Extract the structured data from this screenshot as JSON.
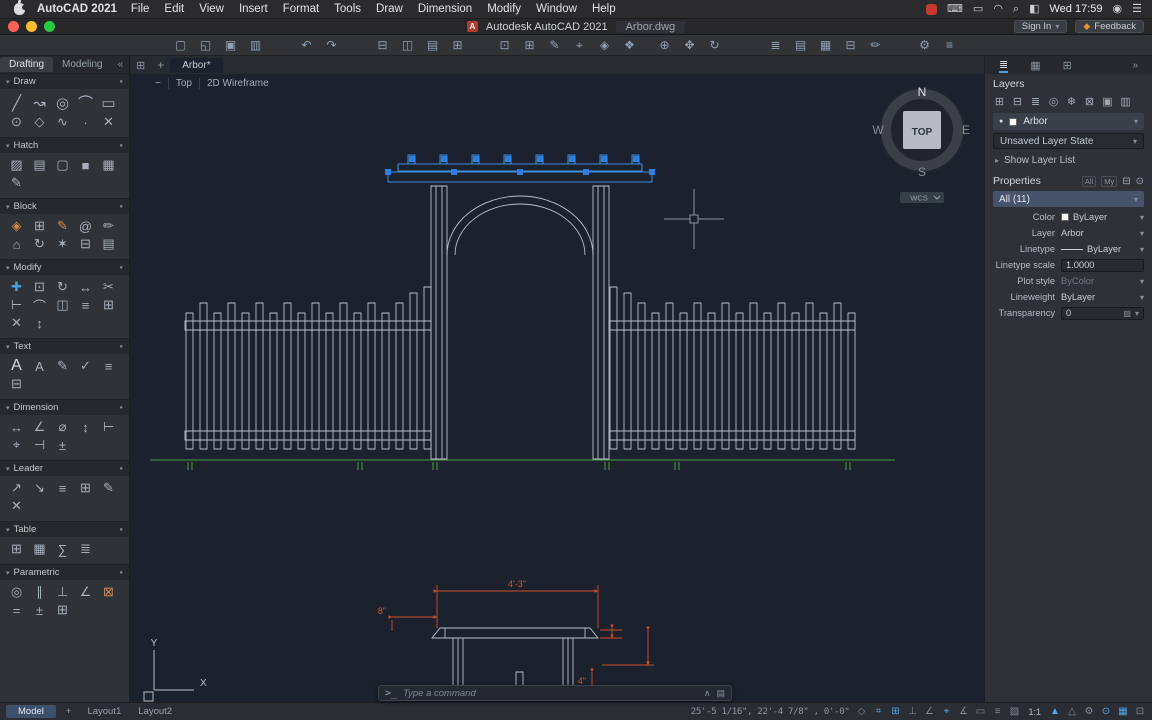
{
  "colors": {
    "selection_blue": "#2e7fe0",
    "accent_blue": "#53a7e8",
    "line_gray": "#b9c0ca",
    "ground_green": "#4f9a4f",
    "dimension_red": "#cf4e2a",
    "feedback_orange": "#e8913a"
  },
  "chrome": {
    "caret_down": "▾",
    "caret_right": "▸",
    "section_dot": "●",
    "collapse_left": "«",
    "collapse_right": "»",
    "plus": "+",
    "grid": "⊞",
    "chevron_up": "∧",
    "history": "▤"
  },
  "menubar": {
    "app_name": "AutoCAD 2021",
    "items": [
      "File",
      "Edit",
      "View",
      "Insert",
      "Format",
      "Tools",
      "Draw",
      "Dimension",
      "Modify",
      "Window",
      "Help"
    ],
    "clock": "Wed 17:59",
    "status_icons": [
      {
        "name": "record-icon",
        "glyph": "",
        "cls": "record"
      },
      {
        "name": "keyboard-input-icon",
        "glyph": "⌨"
      },
      {
        "name": "battery-icon",
        "glyph": "▭"
      },
      {
        "name": "wifi-icon",
        "glyph": "◠"
      },
      {
        "name": "spotlight-icon",
        "glyph": "⌕"
      },
      {
        "name": "control-center-icon",
        "glyph": "◧"
      }
    ],
    "after_clock_icons": [
      {
        "name": "siri-icon",
        "glyph": "◉"
      },
      {
        "name": "notification-center-icon",
        "glyph": "☰"
      }
    ]
  },
  "titlebar": {
    "logo_letter": "A",
    "app_title": "Autodesk AutoCAD 2021",
    "doc_title": "Arbor.dwg",
    "sign_in": "Sign In",
    "feedback": "Feedback"
  },
  "toolbar": {
    "file": [
      {
        "name": "new-file-icon",
        "glyph": "▢"
      },
      {
        "name": "open-file-icon",
        "glyph": "◱"
      },
      {
        "name": "save-icon",
        "glyph": "▣"
      },
      {
        "name": "save-as-icon",
        "glyph": "▥"
      }
    ],
    "edit": [
      {
        "name": "undo-icon",
        "glyph": "↶"
      },
      {
        "name": "redo-icon",
        "glyph": "↷"
      }
    ],
    "print": [
      {
        "name": "print-icon",
        "glyph": "⊟"
      },
      {
        "name": "plot-preview-icon",
        "glyph": "◫"
      },
      {
        "name": "page-setup-icon",
        "glyph": "▤"
      },
      {
        "name": "batch-plot-icon",
        "glyph": "⊞"
      }
    ],
    "tools": [
      {
        "name": "copy-clip-icon",
        "glyph": "⊡"
      },
      {
        "name": "paste-icon",
        "glyph": "⊞"
      },
      {
        "name": "match-properties-icon",
        "glyph": "✎"
      },
      {
        "name": "measure-icon",
        "glyph": "⌖"
      },
      {
        "name": "insert-block-icon",
        "glyph": "◈"
      },
      {
        "name": "group-icon",
        "glyph": "❖"
      }
    ],
    "view": [
      {
        "name": "zoom-icon",
        "glyph": "⊕"
      },
      {
        "name": "pan-icon",
        "glyph": "✥"
      },
      {
        "name": "orbit-icon",
        "glyph": "↻"
      }
    ],
    "manage": [
      {
        "name": "layer-properties-icon",
        "glyph": "≣"
      },
      {
        "name": "properties-palette-icon",
        "glyph": "▤"
      },
      {
        "name": "tool-palettes-icon",
        "glyph": "▦"
      },
      {
        "name": "sheet-set-manager-icon",
        "glyph": "⊟"
      },
      {
        "name": "markup-icon",
        "glyph": "✏"
      }
    ],
    "settings": [
      {
        "name": "workspace-icon",
        "glyph": "⚙"
      },
      {
        "name": "options-icon",
        "glyph": "≡"
      }
    ]
  },
  "palette": {
    "tabs": [
      {
        "label": "Drafting",
        "cls": "active"
      },
      {
        "label": "Modeling"
      }
    ],
    "sections": [
      {
        "label": "Draw",
        "icons": [
          {
            "name": "line-icon",
            "glyph": "╱"
          },
          {
            "name": "polyline-icon",
            "glyph": "↝"
          },
          {
            "name": "circle-icon",
            "glyph": "◎"
          },
          {
            "name": "arc-icon",
            "glyph": "⌒"
          },
          {
            "name": "rectangle-icon",
            "glyph": "▭"
          },
          {
            "name": "ellipse-icon",
            "glyph": "⊙"
          },
          {
            "name": "polygon-icon",
            "glyph": "◇"
          },
          {
            "name": "spline-icon",
            "glyph": "∿"
          },
          {
            "name": "point-icon",
            "glyph": "∙"
          },
          {
            "name": "construction-line-icon",
            "glyph": "✕"
          }
        ]
      },
      {
        "label": "Hatch",
        "icons": [
          {
            "name": "hatch-pattern-icon",
            "glyph": "▨"
          },
          {
            "name": "gradient-icon",
            "glyph": "▤"
          },
          {
            "name": "boundary-icon",
            "glyph": "▢"
          },
          {
            "name": "solid-fill-icon",
            "glyph": "■"
          },
          {
            "name": "hatch-grid-icon",
            "glyph": "▦"
          },
          {
            "name": "hatch-edit-icon",
            "glyph": "✎"
          }
        ]
      },
      {
        "label": "Block",
        "icons": [
          {
            "name": "block-insert-icon",
            "glyph": "◈",
            "cls": "warm"
          },
          {
            "name": "block-create-icon",
            "glyph": "⊞"
          },
          {
            "name": "block-edit-icon",
            "glyph": "✎",
            "cls": "warm"
          },
          {
            "name": "attribute-icon",
            "glyph": "@"
          },
          {
            "name": "attribute-edit-icon",
            "glyph": "✏"
          },
          {
            "name": "set-base-point-icon",
            "glyph": "⌂"
          },
          {
            "name": "block-sync-icon",
            "glyph": "↻"
          },
          {
            "name": "explode-icon",
            "glyph": "✶"
          },
          {
            "name": "block-scan-icon",
            "glyph": "⊟"
          },
          {
            "name": "block-manager-icon",
            "glyph": "▤"
          }
        ]
      },
      {
        "label": "Modify",
        "icons": [
          {
            "name": "move-icon",
            "glyph": "✚",
            "cls": "blue"
          },
          {
            "name": "copy-icon",
            "glyph": "⊡"
          },
          {
            "name": "rotate-icon",
            "glyph": "↻"
          },
          {
            "name": "stretch-icon",
            "glyph": "↔"
          },
          {
            "name": "trim-icon",
            "glyph": "✂"
          },
          {
            "name": "extend-icon",
            "glyph": "⊢"
          },
          {
            "name": "fillet-icon",
            "glyph": "⌒"
          },
          {
            "name": "mirror-icon",
            "glyph": "◫"
          },
          {
            "name": "offset-icon",
            "glyph": "≡"
          },
          {
            "name": "array-icon",
            "glyph": "⊞"
          },
          {
            "name": "erase-icon",
            "glyph": "✕"
          },
          {
            "name": "scale-icon",
            "glyph": "↕"
          }
        ]
      },
      {
        "label": "Text",
        "icons": [
          {
            "name": "mtext-icon",
            "glyph": "A",
            "cls": "bigA"
          },
          {
            "name": "single-text-icon",
            "glyph": "A"
          },
          {
            "name": "text-edit-icon",
            "glyph": "✎"
          },
          {
            "name": "spell-check-icon",
            "glyph": "✓"
          },
          {
            "name": "text-align-icon",
            "glyph": "≡"
          },
          {
            "name": "text-style-icon",
            "glyph": "⊟"
          }
        ]
      },
      {
        "label": "Dimension",
        "icons": [
          {
            "name": "linear-dimension-icon",
            "glyph": "↔"
          },
          {
            "name": "angular-dimension-icon",
            "glyph": "∠"
          },
          {
            "name": "diameter-dimension-icon",
            "glyph": "⌀"
          },
          {
            "name": "vertical-dimension-icon",
            "glyph": "↕"
          },
          {
            "name": "baseline-dimension-icon",
            "glyph": "⊢"
          },
          {
            "name": "center-mark-icon",
            "glyph": "⌖"
          },
          {
            "name": "continue-dimension-icon",
            "glyph": "⊣"
          },
          {
            "name": "tolerance-icon",
            "glyph": "±"
          }
        ]
      },
      {
        "label": "Leader",
        "icons": [
          {
            "name": "multileader-icon",
            "glyph": "↗"
          },
          {
            "name": "leader-icon",
            "glyph": "↘"
          },
          {
            "name": "leader-align-icon",
            "glyph": "≡"
          },
          {
            "name": "leader-collect-icon",
            "glyph": "⊞"
          },
          {
            "name": "leader-edit-icon",
            "glyph": "✎"
          },
          {
            "name": "leader-remove-icon",
            "glyph": "✕"
          }
        ]
      },
      {
        "label": "Table",
        "icons": [
          {
            "name": "table-icon",
            "glyph": "⊞"
          },
          {
            "name": "table-cell-icon",
            "glyph": "▦"
          },
          {
            "name": "formula-icon",
            "glyph": "∑"
          },
          {
            "name": "table-export-icon",
            "glyph": "≣"
          }
        ]
      },
      {
        "label": "Parametric",
        "icons": [
          {
            "name": "coincident-constraint-icon",
            "glyph": "◎"
          },
          {
            "name": "parallel-constraint-icon",
            "glyph": "∥"
          },
          {
            "name": "perpendicular-constraint-icon",
            "glyph": "⊥"
          },
          {
            "name": "angle-constraint-icon",
            "glyph": "∠"
          },
          {
            "name": "lock-constraint-icon",
            "glyph": "⊠",
            "cls": "warm"
          },
          {
            "name": "equal-constraint-icon",
            "glyph": "="
          },
          {
            "name": "tolerance-constraint-icon",
            "glyph": "±"
          },
          {
            "name": "show-constraints-icon",
            "glyph": "⊞"
          }
        ]
      }
    ]
  },
  "canvas": {
    "file_tab": "Arbor*",
    "viewport": {
      "menu": "−",
      "view": "Top",
      "style": "2D Wireframe"
    },
    "compass": {
      "n": "N",
      "e": "E",
      "s": "S",
      "w": "W",
      "cube": "TOP",
      "wcs": "WCS"
    },
    "axis": {
      "x": "X",
      "y": "Y"
    },
    "command": {
      "prompt": ">_",
      "placeholder": "Type a command"
    },
    "dims": {
      "width": "4'-3\"",
      "overhang": "8\"",
      "thickness": "4\""
    }
  },
  "panels": {
    "tabs": [
      {
        "name": "layers-palette-tab",
        "glyph": "≣",
        "cls": "active"
      },
      {
        "name": "materials-palette-tab",
        "glyph": "▦"
      },
      {
        "name": "sheets-palette-tab",
        "glyph": "⊞"
      }
    ]
  },
  "layers": {
    "title": "Layers",
    "tools": [
      {
        "name": "layer-new-icon",
        "glyph": "⊞"
      },
      {
        "name": "layer-delete-icon",
        "glyph": "⊟"
      },
      {
        "name": "layer-state-icon",
        "glyph": "≣"
      },
      {
        "name": "layer-isolate-icon",
        "glyph": "◎"
      },
      {
        "name": "layer-freeze-icon",
        "glyph": "❄"
      },
      {
        "name": "layer-lock-icon",
        "glyph": "⊠"
      },
      {
        "name": "layer-color-icon",
        "glyph": "▣"
      },
      {
        "name": "layer-merge-icon",
        "glyph": "▥"
      }
    ],
    "status_dot": "●",
    "current": "Arbor",
    "state": "Unsaved Layer State",
    "show_list": "Show Layer List"
  },
  "properties": {
    "title": "Properties",
    "toggles": [
      "All",
      "My"
    ],
    "header_icons": [
      {
        "name": "quick-select-icon",
        "glyph": "⊟"
      },
      {
        "name": "properties-pin-icon",
        "glyph": "⊙"
      }
    ],
    "selector": "All (11)",
    "rows": [
      {
        "label": "Color",
        "value": "ByLayer"
      },
      {
        "label": "Layer",
        "value": "Arbor"
      },
      {
        "label": "Linetype",
        "value": "ByLayer"
      },
      {
        "label": "Linetype scale",
        "value": "1.0000"
      },
      {
        "label": "Plot style",
        "value": "ByColor"
      },
      {
        "label": "Lineweight",
        "value": "ByLayer"
      },
      {
        "label": "Transparency",
        "value": "0"
      }
    ]
  },
  "statusbar": {
    "model": "Model",
    "layouts": [
      "Layout1",
      "Layout2"
    ],
    "coords": "25'-5 1/16\", 22'-4 7/8\" , 0'-0\"",
    "icons": [
      {
        "name": "infer-constraints-icon",
        "glyph": "◇"
      },
      {
        "name": "snap-mode-icon",
        "glyph": "⌗",
        "cls": "on"
      },
      {
        "name": "grid-display-icon",
        "glyph": "⊞",
        "cls": "on"
      },
      {
        "name": "ortho-mode-icon",
        "glyph": "⊥"
      },
      {
        "name": "polar-tracking-icon",
        "glyph": "∠"
      },
      {
        "name": "object-snap-icon",
        "glyph": "⌖",
        "cls": "on"
      },
      {
        "name": "object-snap-tracking-icon",
        "glyph": "∡"
      },
      {
        "name": "dynamic-input-icon",
        "glyph": "▭"
      },
      {
        "name": "lineweight-display-icon",
        "glyph": "≡"
      },
      {
        "name": "transparency-display-icon",
        "glyph": "▨"
      }
    ],
    "scale": "1:1",
    "icons_right": [
      {
        "name": "annotation-visibility-icon",
        "glyph": "▲",
        "cls": "on"
      },
      {
        "name": "annotation-autoscale-icon",
        "glyph": "△"
      },
      {
        "name": "workspace-switching-icon",
        "glyph": "⚙"
      },
      {
        "name": "object-isolate-icon",
        "glyph": "⊙",
        "cls": "on"
      },
      {
        "name": "graphics-performance-icon",
        "glyph": "▦",
        "cls": "on"
      },
      {
        "name": "clean-screen-icon",
        "glyph": "⊡"
      }
    ]
  }
}
